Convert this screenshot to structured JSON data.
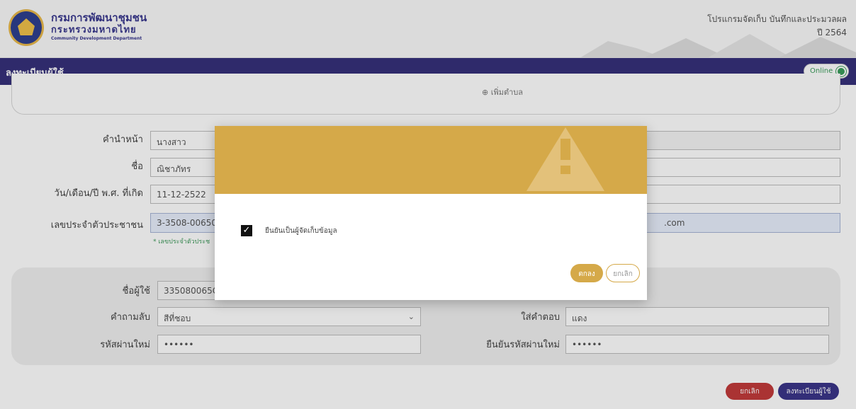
{
  "header": {
    "org_name_th": "กรมการพัฒนาชุมชน",
    "ministry_th": "กระทรวงมหาดไทย",
    "org_name_en": "Community Development Department",
    "program_title": "โปรแกรมจัดเก็บ บันทึกและประมวลผล",
    "year": "ปี 2564"
  },
  "titlebar": {
    "title": "ลงทะเบียนผู้ใช้",
    "status": "Online"
  },
  "form": {
    "add_subdistrict": "⊕ เพิ่มตำบล",
    "prefix_label": "คำนำหน้า",
    "prefix_value": "นางสาว",
    "name_label": "ชื่อ",
    "name_value": "ณิชาภัทร",
    "dob_label": "วัน/เดือน/ปี พ.ศ. ที่เกิด",
    "dob_value": "11-12-2522",
    "idcard_label": "เลขประจำตัวประชาชน",
    "idcard_value": "3-3508-00650",
    "idcard_note": "* เลขประจำตัวประช",
    "email_value": ".com",
    "username_label": "ชื่อผู้ใช้",
    "username_value": "335080065C",
    "question_label": "คำถามลับ",
    "question_value": "สีที่ชอบ",
    "answer_label": "ใส่คำตอบ",
    "answer_value": "แดง",
    "password_label": "รหัสผ่านใหม่",
    "password_value": "••••••",
    "confirm_label": "ยืนยันรหัสผ่านใหม่",
    "confirm_value": "••••••"
  },
  "buttons": {
    "cancel": "ยกเลิก",
    "register": "ลงทะเบียนผู้ใช้"
  },
  "modal": {
    "checkbox_label": "ยืนยันเป็นผู้จัดเก็บข้อมูล",
    "ok": "ตกลง",
    "cancel": "ยกเลิก"
  },
  "colors": {
    "primary": "#36307a",
    "warning": "#d5a949",
    "danger": "#c23b3b",
    "online": "#3a9c5a"
  }
}
